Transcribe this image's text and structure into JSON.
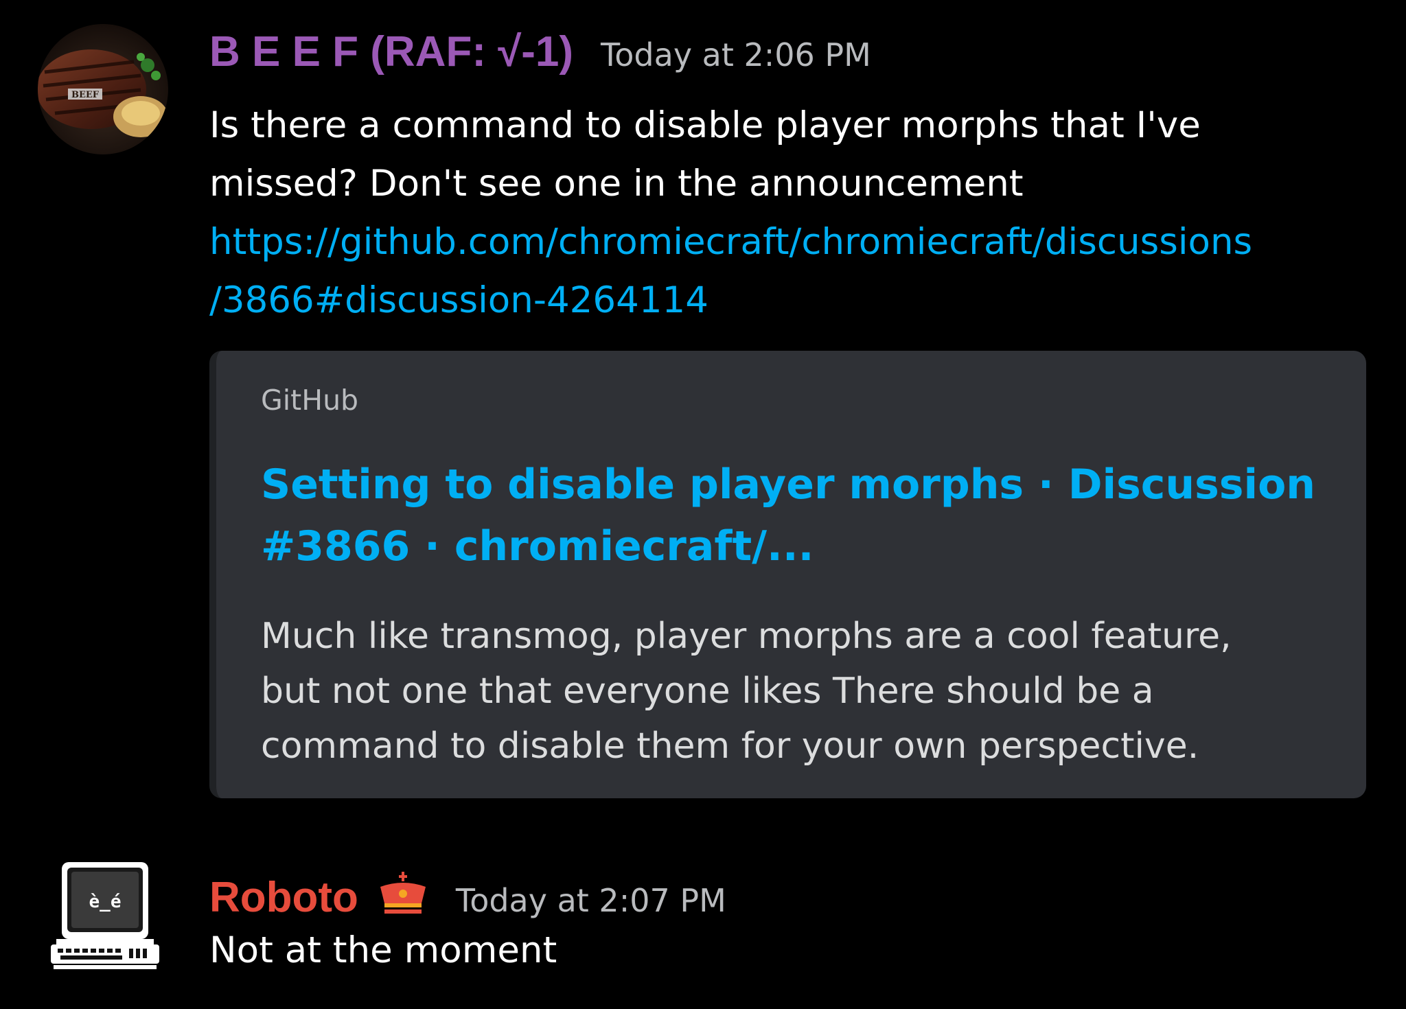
{
  "messages": [
    {
      "username": "B E E F (RAF: √-1)",
      "username_color": "#9b59b6",
      "timestamp": "Today at 2:06 PM",
      "avatar_label": "BEEF",
      "text_line1": "Is there a command to disable player morphs that I've",
      "text_line2": "missed? Don't see one in the announcement",
      "link_line1": "https://github.com/chromiecraft/chromiecraft/discussions",
      "link_line2": "/3866#discussion-4264114",
      "embed": {
        "provider": "GitHub",
        "title_line1": "Setting to disable player morphs · Discussion",
        "title_line2": "#3866 · chromiecraft/...",
        "desc_line1": "Much like transmog, player morphs are a cool feature,",
        "desc_line2": "but not one that everyone likes There should be a",
        "desc_line3": "command to disable them for your own perspective."
      }
    },
    {
      "username": "Roboto",
      "username_color": "#e74c3c",
      "badge_icon": "crown-icon",
      "timestamp": "Today at 2:07 PM",
      "avatar_face": "è_é",
      "text": "Not at the moment"
    }
  ],
  "colors": {
    "background": "#000000",
    "link": "#00aff4",
    "embed_bg": "#2f3136",
    "timestamp": "#b9bbbe"
  }
}
